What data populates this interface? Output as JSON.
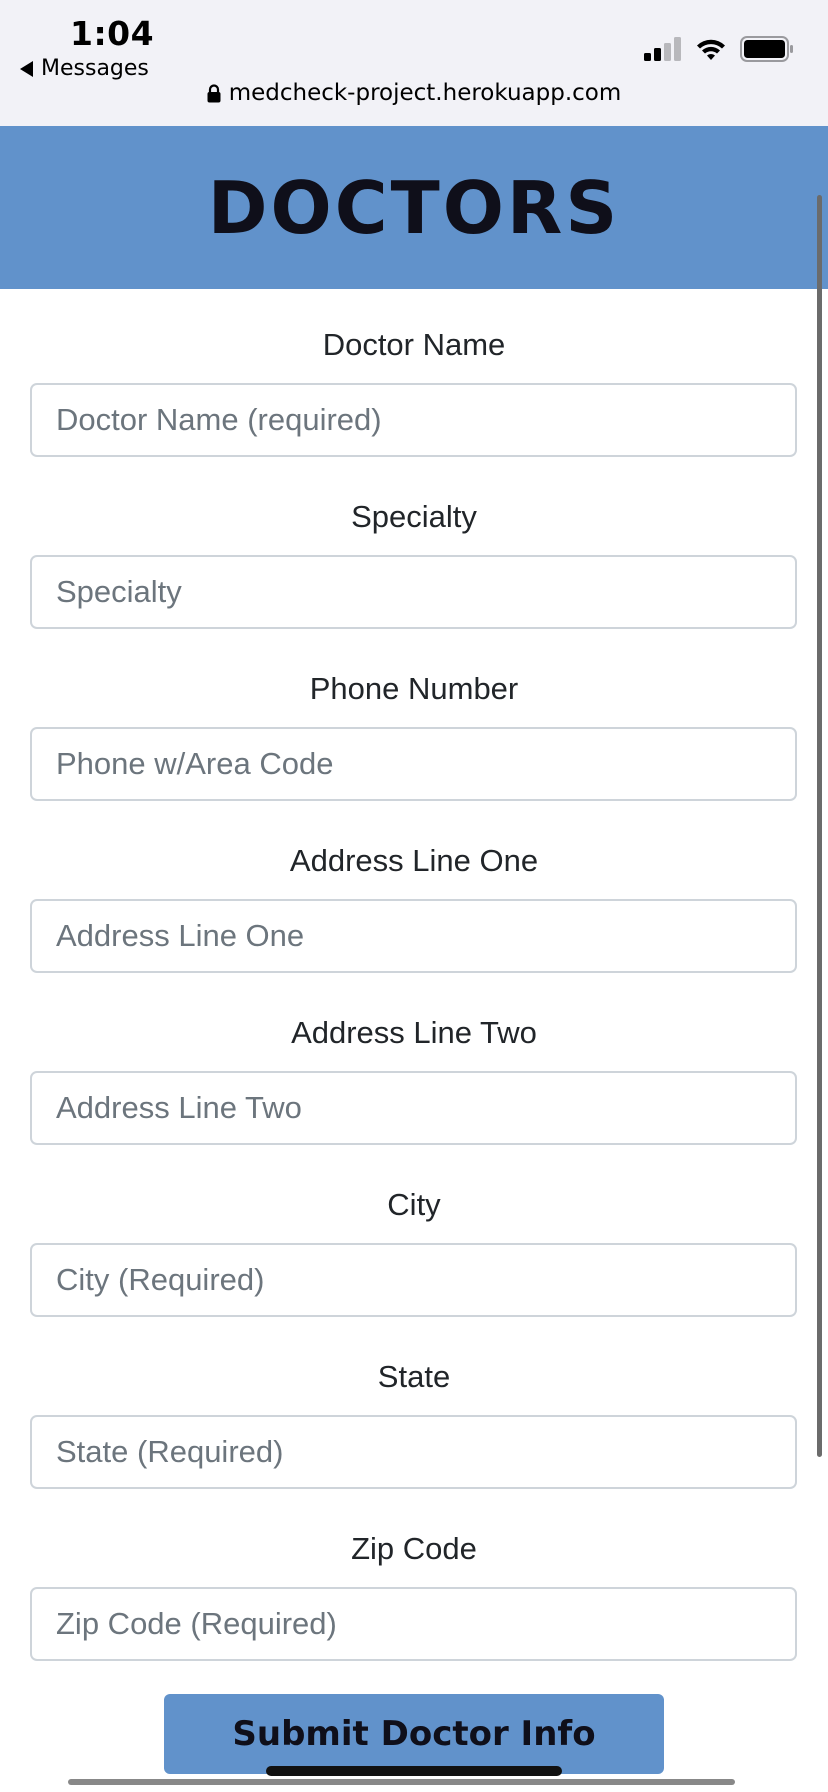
{
  "status_bar": {
    "time": "1:04",
    "back_label": "Messages"
  },
  "url_bar": {
    "url": "medcheck-project.herokuapp.com"
  },
  "header": {
    "title": "DOCTORS"
  },
  "form": {
    "fields": [
      {
        "label": "Doctor Name",
        "placeholder": "Doctor Name (required)",
        "value": ""
      },
      {
        "label": "Specialty",
        "placeholder": "Specialty",
        "value": ""
      },
      {
        "label": "Phone Number",
        "placeholder": "Phone w/Area Code",
        "value": ""
      },
      {
        "label": "Address Line One",
        "placeholder": "Address Line One",
        "value": ""
      },
      {
        "label": "Address Line Two",
        "placeholder": "Address Line Two",
        "value": ""
      },
      {
        "label": "City",
        "placeholder": "City (Required)",
        "value": ""
      },
      {
        "label": "State",
        "placeholder": "State (Required)",
        "value": ""
      },
      {
        "label": "Zip Code",
        "placeholder": "Zip Code (Required)",
        "value": ""
      }
    ],
    "submit_label": "Submit Doctor Info"
  },
  "colors": {
    "header_bg": "#6192cb",
    "button_bg": "#6192cb",
    "title_text": "#0f0f1a"
  }
}
